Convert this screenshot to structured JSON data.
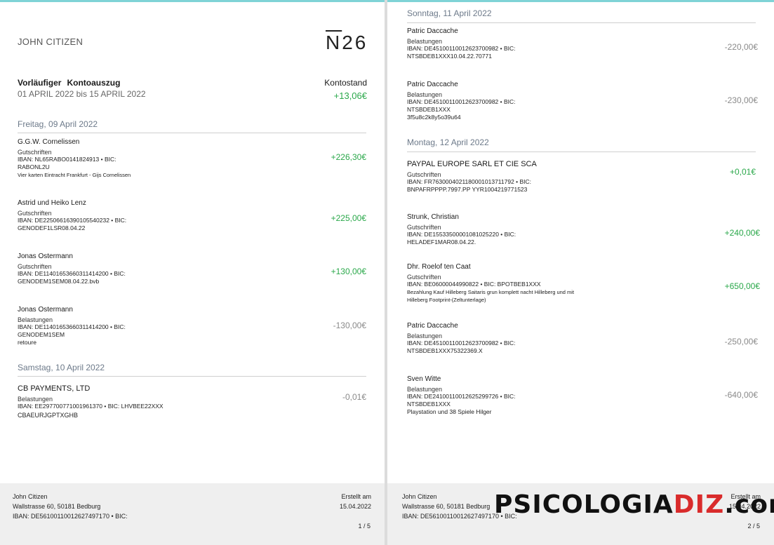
{
  "page1": {
    "header": {
      "name": "JOHN CITIZEN",
      "logo": "N26"
    },
    "statement": {
      "title_word1": "Vorläufiger",
      "title_word2": "Kontoauszug",
      "period": "01 APRIL 2022 bis 15 APRIL 2022",
      "balance_label": "Kontostand",
      "balance_value": "+13,06€"
    },
    "days": [
      {
        "label": "Freitag, 09 April 2022",
        "transactions": [
          {
            "name": "G.G.W. Cornelissen",
            "type": "Gutschriften",
            "line1": "IBAN: NL65RABO0141824913 • BIC:",
            "line2": "RABONL2U",
            "line3": "Vier karten Eintracht Frankfurt - Gijs Cornelissen",
            "amount": "+226,30€"
          },
          {
            "name": "Astrid und Heiko Lenz",
            "type": "Gutschriften",
            "line1": "IBAN: DE22506616390105540232 • BIC:",
            "line2": "GENODEF1LSR08.04.22",
            "amount": "+225,00€"
          },
          {
            "name": "Jonas Ostermann",
            "type": "Gutschriften",
            "line1": "IBAN: DE11401653660311414200 • BIC:",
            "line2": "GENODEM1SEM08.04.22.bvb",
            "amount": "+130,00€"
          },
          {
            "name": "Jonas Ostermann",
            "type": "Belastungen",
            "line1": "IBAN: DE11401653660311414200 • BIC:",
            "line2": "GENODEM1SEM",
            "line3": "retoure",
            "amount": "-130,00€"
          }
        ]
      },
      {
        "label": "Samstag, 10 April 2022",
        "transactions": [
          {
            "name": "CB PAYMENTS, LTD",
            "type": "Belastungen",
            "line1": "IBAN: EE297700771001961370 • BIC: LHVBEE22XXX",
            "line2": "CBAEURJGPTXGHB",
            "amount": "-0,01€"
          }
        ]
      }
    ],
    "footer": {
      "name": "John Citizen",
      "address": "Wallstrasse 60, 50181 Bedburg",
      "iban": "IBAN:  DE56100110012627497170  •  BIC:",
      "created_label": "Erstellt  am",
      "created_date": "15.04.2022",
      "page": "1 / 5"
    }
  },
  "page2": {
    "days": [
      {
        "label": "Sonntag, 11 April 2022",
        "transactions": [
          {
            "name": "Patric Daccache",
            "type": "Belastungen",
            "line1": "IBAN: DE45100110012623700982 • BIC:",
            "line2": "NTSBDEB1XXX10.04.22.70771",
            "amount": "-220,00€"
          },
          {
            "name": "Patric Daccache",
            "type": "Belastungen",
            "line1": "IBAN: DE45100110012623700982 • BIC:",
            "line2": "NTSBDEB1XXX",
            "line3": "3f5u8c2k8y5o39u64",
            "amount": "-230,00€"
          }
        ]
      },
      {
        "label": "Montag, 12 April 2022",
        "transactions": [
          {
            "name": "PAYPAL EUROPE SARL ET CIE SCA",
            "type": "Gutschriften",
            "line1": "IBAN: FR7630004021180001013711792 • BIC:",
            "line2": "BNPAFRPPPP.7997.PP YYR1004219771523",
            "amount": "+0,01€"
          },
          {
            "name": "Strunk, Christian",
            "type": "Gutschriften",
            "line1": "IBAN: DE15533500001081025220 • BIC:",
            "line2": "HELADEF1MAR08.04.22.",
            "amount": "+240,00€"
          },
          {
            "name": "Dhr. Roelof ten Caat",
            "type": "Gutschriften",
            "line1": "IBAN: BE06000044990822 • BIC: BPOTBEB1XXX",
            "line2": "Bezahlung Kauf Hilleberg Saitaris grun komplett nacht Hilleberg und mit",
            "line3": "Hilleberg Footprint-(Zeltunterlage)",
            "amount": "+650,00€"
          },
          {
            "name": "Patric Daccache",
            "type": "Belastungen",
            "line1": "IBAN: DE45100110012623700982 • BIC:",
            "line2": "NTSBDEB1XXX75322369.X",
            "amount": "-250,00€"
          },
          {
            "name": "Sven Witte",
            "type": "Belastungen",
            "line1": "IBAN: DE24100110012625299726 • BIC:",
            "line2": "NTSBDEB1XXX",
            "line3": "Playstation und 38 Spiele Hilger",
            "amount": "-640,00€"
          }
        ]
      }
    ],
    "footer": {
      "name": "John Citizen",
      "address": "Wallstrasse 60, 50181 Bedburg",
      "iban": "IBAN:  DE56100110012627497170  •  BIC:",
      "created_label": "Erstellt  am",
      "created_date": "15.04.2022",
      "page": "2 / 5"
    },
    "watermark": {
      "part1": "PSICOLOGIA",
      "part2": "DIZ",
      "part3": ".com"
    }
  },
  "colors": {
    "positive": "#2aa84a",
    "negative": "#8a8a8a",
    "accent_bar": "#7fd3d6",
    "watermark_red": "#d92b2b"
  }
}
